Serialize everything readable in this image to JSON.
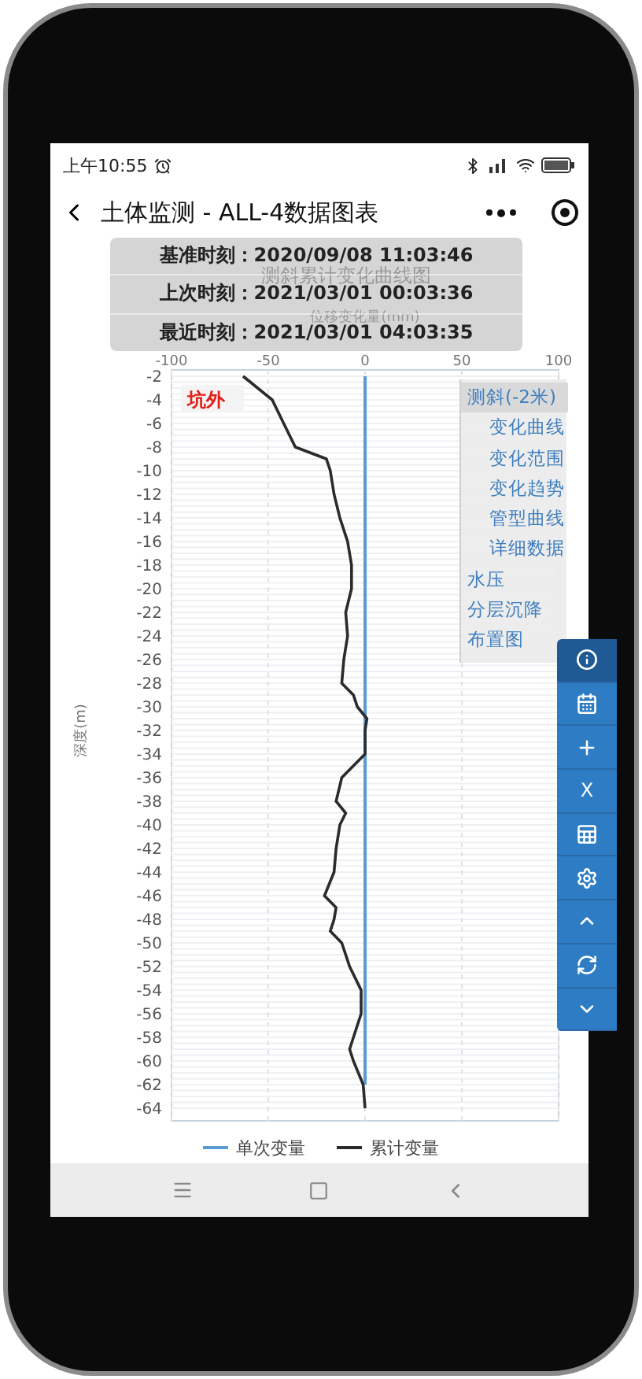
{
  "status_bar": {
    "time": "上午10:55"
  },
  "nav_bar": {
    "title": "土体监测 - ALL-4数据图表"
  },
  "info_overlay": [
    {
      "label": "基准时刻：",
      "value": "2020/09/08 11:03:46"
    },
    {
      "label": "上次时刻：",
      "value": "2021/03/01 00:03:36"
    },
    {
      "label": "最近时刻：",
      "value": "2021/03/01 04:03:35"
    }
  ],
  "chart": {
    "title": "测斜累计变化曲线图",
    "xlabel": "位移变化量(mm)",
    "ylabel": "深度(m)",
    "zone_label": "坑外",
    "x_ticks": [
      "-100",
      "-50",
      "0",
      "50",
      "100"
    ],
    "y_ticks": [
      "-2",
      "-4",
      "-6",
      "-8",
      "-10",
      "-12",
      "-14",
      "-16",
      "-18",
      "-20",
      "-22",
      "-24",
      "-26",
      "-28",
      "-30",
      "-32",
      "-34",
      "-36",
      "-38",
      "-40",
      "-42",
      "-44",
      "-46",
      "-48",
      "-50",
      "-52",
      "-54",
      "-56",
      "-58",
      "-60",
      "-62",
      "-64"
    ],
    "legend": [
      {
        "name": "单次变量",
        "color": "#5b9bd5"
      },
      {
        "name": "累计变量",
        "color": "#2b2b2b"
      }
    ]
  },
  "side_menu": [
    {
      "label": "测斜(-2米)",
      "selected": true,
      "children": [
        {
          "label": "变化曲线",
          "selected": false
        },
        {
          "label": "变化范围",
          "selected": false
        },
        {
          "label": "变化趋势",
          "selected": false
        },
        {
          "label": "管型曲线",
          "selected": false
        },
        {
          "label": "详细数据",
          "selected": false
        }
      ]
    },
    {
      "label": "水压",
      "selected": false
    },
    {
      "label": "分层沉降",
      "selected": false
    },
    {
      "label": "布置图",
      "selected": false
    }
  ],
  "toolbar": [
    {
      "kind": "info",
      "selected": true
    },
    {
      "kind": "calendar",
      "selected": false
    },
    {
      "kind": "plus",
      "selected": false
    },
    {
      "kind": "text",
      "text": "X",
      "selected": false
    },
    {
      "kind": "excel",
      "selected": false
    },
    {
      "kind": "gear",
      "selected": false
    },
    {
      "kind": "up",
      "selected": false
    },
    {
      "kind": "refresh",
      "selected": false
    },
    {
      "kind": "down",
      "selected": false
    }
  ]
}
